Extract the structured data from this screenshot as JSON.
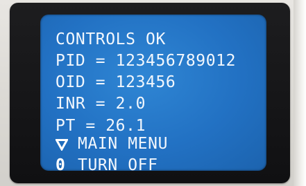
{
  "display": {
    "status": "CONTROLS OK",
    "pid_line": "PID = 123456789012",
    "oid_line": "OID = 123456",
    "inr_line": "INR = 2.0",
    "pt_line": "PT = 26.1"
  },
  "menu": {
    "main_menu_label": "MAIN MENU",
    "main_menu_icon": "down-triangle-icon",
    "turn_off_label": "TURN OFF",
    "turn_off_icon_glyph": "0"
  },
  "colors": {
    "screen_blue": "#2271c3",
    "text": "#f2f7fd",
    "bezel": "#101012"
  }
}
